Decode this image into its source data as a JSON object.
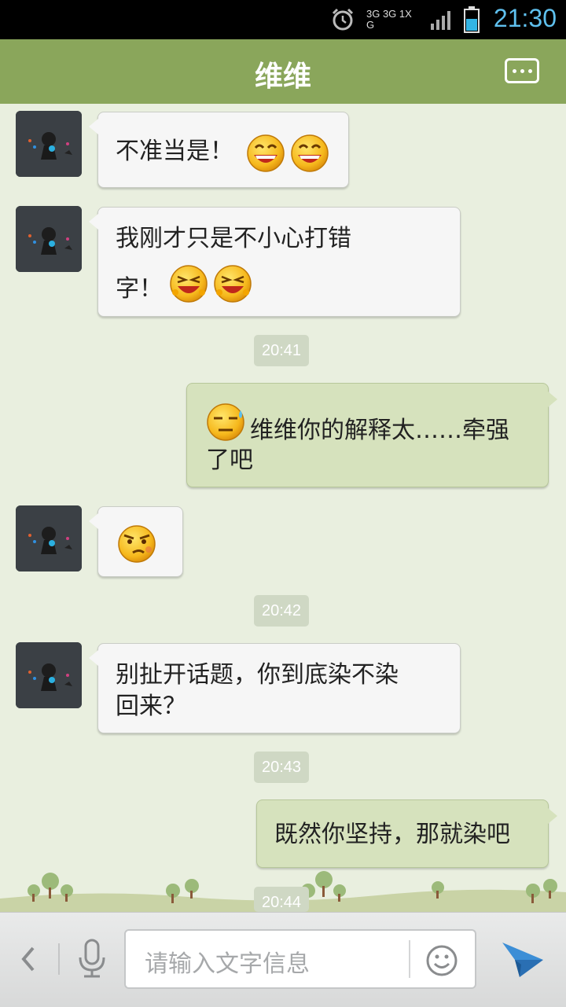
{
  "status_bar": {
    "time": "21:30",
    "network_top": "3G 3G 1X G"
  },
  "header": {
    "title": "维维"
  },
  "messages": [
    {
      "side": "in",
      "text": "不准当是！",
      "emojis": [
        "grin",
        "grin"
      ]
    },
    {
      "side": "in",
      "line1": "我刚才只是不小心打错",
      "line2": "字！",
      "emojis": [
        "laugh",
        "laugh"
      ]
    },
    {
      "type": "time",
      "text": "20:41"
    },
    {
      "side": "out",
      "line1": "维维你的解释太……牵强",
      "line2": "了吧",
      "emojis": [
        "sweat"
      ]
    },
    {
      "side": "in",
      "emojis": [
        "smirk"
      ]
    },
    {
      "type": "time",
      "text": "20:42"
    },
    {
      "side": "in",
      "line1": "别扯开话题，你到底染不染",
      "line2": "回来？"
    },
    {
      "type": "time",
      "text": "20:43"
    },
    {
      "side": "out",
      "text": "既然你坚持，那就染吧"
    },
    {
      "type": "time",
      "text": "20:44"
    }
  ],
  "input_bar": {
    "placeholder": "请输入文字信息"
  },
  "icons": [
    "alarm-icon",
    "signal-icon",
    "battery-icon",
    "more-icon",
    "back-icon",
    "microphone-icon",
    "emoji-icon",
    "send-icon"
  ],
  "colors": {
    "title_bar": "#8aa65b",
    "chat_bg": "#e9efdf",
    "out_bubble": "#d6e2bd",
    "in_bubble": "#f6f6f6",
    "time_accent": "#5fc0ee"
  }
}
